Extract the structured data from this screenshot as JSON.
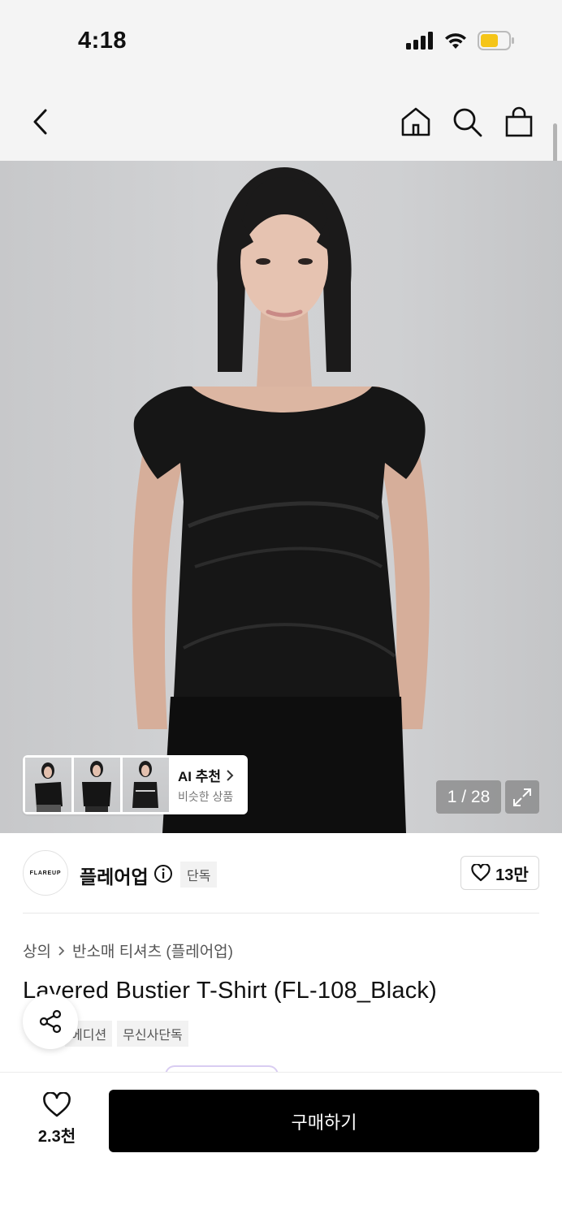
{
  "status_bar": {
    "time": "4:18"
  },
  "header": {
    "back_icon": "chevron-left-icon",
    "home_icon": "home-icon",
    "search_icon": "search-icon",
    "cart_icon": "shopping-bag-icon"
  },
  "gallery": {
    "counter": "1 / 28",
    "ai_recommend": {
      "title": "AI 추천",
      "subtitle": "비슷한 상품"
    }
  },
  "brand": {
    "logo_text": "FLAREUP",
    "name": "플레어업",
    "exclusive_tag": "단독",
    "likes": "13만"
  },
  "product": {
    "breadcrumb": [
      "상의",
      "반소매 티셔츠 (플레어업)"
    ],
    "title": "Layered Bustier T-Shirt (FL-108_Black)",
    "tags": [
      "에디션",
      "무신사단독"
    ]
  },
  "bottom": {
    "wish_count": "2.3천",
    "buy_label": "구매하기"
  },
  "colors": {
    "accent": "#000000",
    "background": "#f4f4f4",
    "battery": "#f5c518"
  }
}
